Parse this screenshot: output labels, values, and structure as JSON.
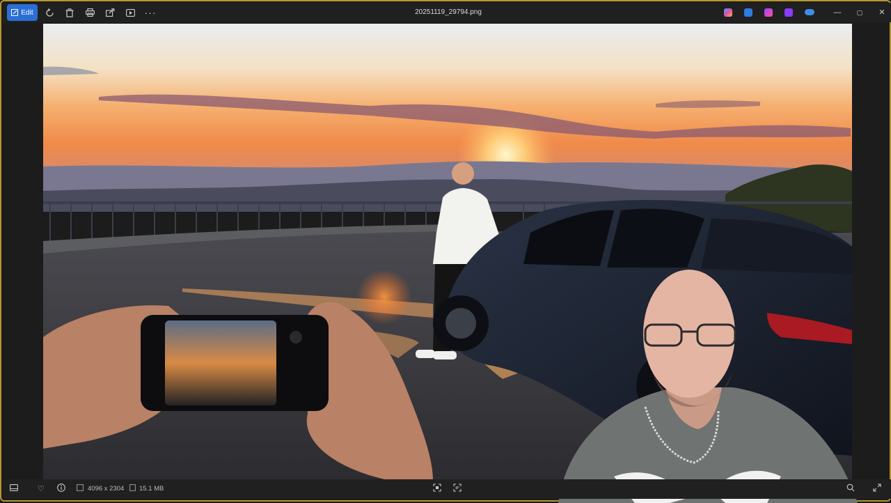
{
  "toolbar": {
    "edit_label": "Edit",
    "file_name": "20251119_29794.png",
    "icons": [
      "rotate-icon",
      "delete-icon",
      "print-icon",
      "share-icon",
      "slideshow-icon",
      "more-icon"
    ],
    "window_controls": {
      "minimize": "—",
      "maximize": "▢",
      "close": "✕"
    }
  },
  "status_bar": {
    "dimensions": "4096 x 2304",
    "file_size": "15.1 MB"
  },
  "colors": {
    "accent": "#2b6fd6",
    "frame": "#b8962e"
  }
}
